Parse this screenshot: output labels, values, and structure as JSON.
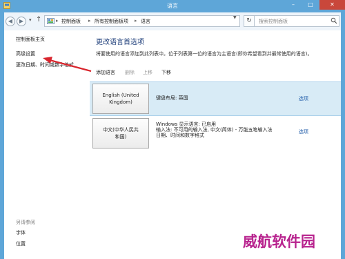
{
  "window": {
    "title": "语言",
    "minimize": "–",
    "maximize": "□",
    "close": "✕"
  },
  "address_bar": {
    "recent_icon": "chevron-down-icon",
    "up_icon": "up-arrow-icon",
    "crumbs": [
      "控制面板",
      "所有控制面板项",
      "语言"
    ],
    "separator": "▸",
    "search_placeholder": "搜索控制面板"
  },
  "sidebar": {
    "home": "控制面板主页",
    "advanced": "高级设置",
    "date_time": "更改日期、时间或数字格式",
    "see_also_header": "另请参阅",
    "fonts": "字体",
    "location": "位置"
  },
  "main": {
    "title": "更改语言首选项",
    "description": "将要使用的语言添加到此列表中。位于列表第一位的语言为主语言(即你希望看到并最常使用的语言)。",
    "toolbar": {
      "add": "添加语言",
      "delete": "删除",
      "move_up": "上移",
      "move_down": "下移"
    },
    "languages": [
      {
        "name_line1": "English (United",
        "name_line2": "Kingdom)",
        "info_line1": "键盘布局: 英国",
        "options": "选项"
      },
      {
        "name_line1": "中文(中华人民共",
        "name_line2": "和国)",
        "info_line1": "Windows 显示语言: 已启用",
        "info_line2": "输入法: 不可用的输入法, 中文(简体) - 万能五笔输入法",
        "info_line3": "日期、时间和数字格式",
        "options": "选项"
      }
    ]
  },
  "watermark": "威航软件园",
  "colors": {
    "title_bar": "#5ea6d8",
    "close_button": "#c9473b",
    "selected_row": "#d8ebf6",
    "link": "#1f5ba8",
    "annotation_arrow": "#d9262e",
    "watermark": "#b8238e"
  }
}
